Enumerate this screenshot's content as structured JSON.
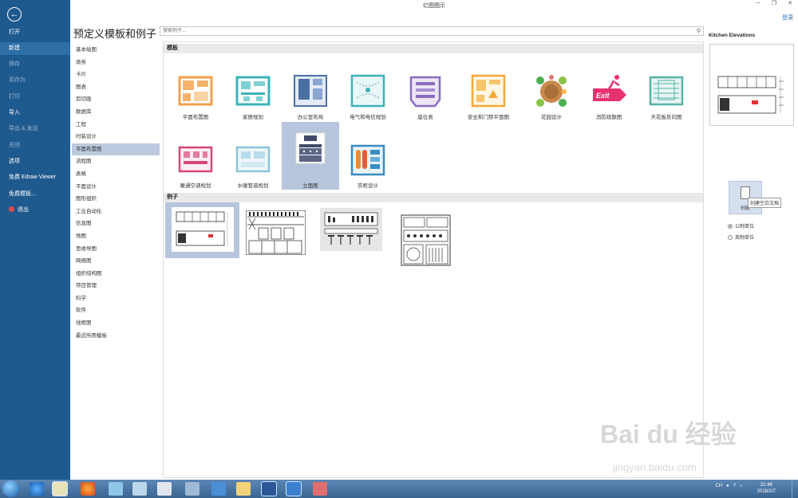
{
  "window": {
    "title": "亿图图示",
    "login": "登录",
    "controls": [
      "─",
      "❐",
      "✕"
    ]
  },
  "leftnav": {
    "items": [
      {
        "label": "打开",
        "state": "normal"
      },
      {
        "label": "新建",
        "state": "active"
      },
      {
        "label": "保存",
        "state": "dim"
      },
      {
        "label": "另存为",
        "state": "dim"
      },
      {
        "label": "打印",
        "state": "dim"
      },
      {
        "label": "导入",
        "state": "normal"
      },
      {
        "label": "导出 & 发送",
        "state": "dim"
      },
      {
        "label": "关闭",
        "state": "dim"
      },
      {
        "label": "选项",
        "state": "normal"
      },
      {
        "label": "免费 Edraw Viewer",
        "state": "normal"
      },
      {
        "label": "免费模板...",
        "state": "normal"
      },
      {
        "label": "退出",
        "state": "normal"
      }
    ]
  },
  "page_title": "预定义模板和例子",
  "search": {
    "placeholder": "搜索例子..."
  },
  "categories": [
    "基本绘图",
    "商务",
    "卡片",
    "图表",
    "剪切画",
    "数据库",
    "工程",
    "时装设计",
    "平面布置图",
    "流程图",
    "表格",
    "平面设计",
    "图形组织",
    "工业自动化",
    "信息图",
    "地图",
    "思维导图",
    "网络图",
    "组织结构图",
    "项目管理",
    "科学",
    "软件",
    "线框图",
    "最近所用模板"
  ],
  "selected_category": "平面布置图",
  "templates_header": "模板",
  "templates": [
    {
      "label": "平面布置图",
      "icon": "floor-plan-icon"
    },
    {
      "label": "家居规划",
      "icon": "home-plan-icon"
    },
    {
      "label": "办公室布局",
      "icon": "office-layout-icon"
    },
    {
      "label": "电气和电信规划",
      "icon": "electrical-plan-icon"
    },
    {
      "label": "座位表",
      "icon": "seating-chart-icon"
    },
    {
      "label": "安全和门禁平面图",
      "icon": "security-plan-icon"
    },
    {
      "label": "花园设计",
      "icon": "garden-design-icon"
    },
    {
      "label": "消防疏散图",
      "icon": "fire-exit-icon"
    },
    {
      "label": "天花板反向图",
      "icon": "ceiling-plan-icon"
    },
    {
      "label": "暖通空调规划",
      "icon": "hvac-plan-icon"
    },
    {
      "label": "水暖管道规划",
      "icon": "plumbing-plan-icon"
    },
    {
      "label": "立面图",
      "icon": "elevation-icon",
      "selected": true
    },
    {
      "label": "衣柜设计",
      "icon": "wardrobe-icon"
    }
  ],
  "examples_header": "例子",
  "examples": [
    {
      "name": "kitchen-elevation-1",
      "selected": true
    },
    {
      "name": "cabinet-elevation"
    },
    {
      "name": "bar-counter-elevation"
    },
    {
      "name": "laundry-elevation"
    }
  ],
  "right_panel": {
    "title": "Kitchen Elevations",
    "create_label": "创建",
    "tooltip": "创建空白文档",
    "units": [
      {
        "label": "公制单位",
        "checked": true
      },
      {
        "label": "英制单位",
        "checked": false
      }
    ]
  },
  "taskbar": {
    "tray_text": "CH",
    "time": "21:46",
    "date": "2018/2/7"
  },
  "watermark": {
    "main": "Bai du 经验",
    "sub": "jingyan.baidu.com"
  }
}
